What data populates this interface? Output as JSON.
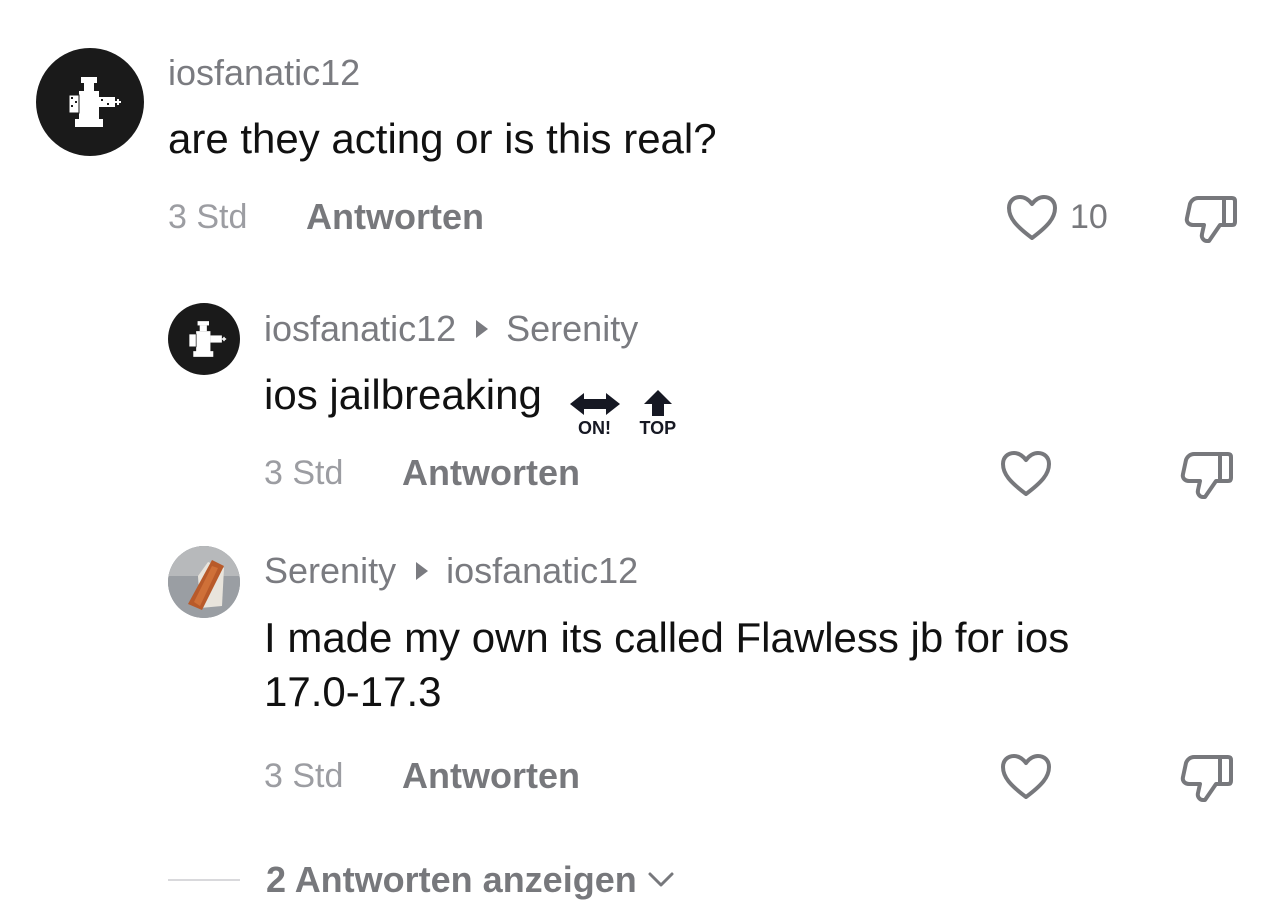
{
  "comments": [
    {
      "username": "iosfanatic12",
      "reply_to": "",
      "text": "are they acting or is this real?",
      "time": "3 Std",
      "reply_label": "Antworten",
      "likes": "10",
      "avatar_icon": "chess-rook-icon"
    },
    {
      "username": "iosfanatic12",
      "reply_to": "Serenity",
      "text": "ios jailbreaking",
      "emoji": [
        "ON!",
        "TOP"
      ],
      "time": "3 Std",
      "reply_label": "Antworten",
      "likes": "",
      "avatar_icon": "chess-rook-icon"
    },
    {
      "username": "Serenity",
      "reply_to": "iosfanatic12",
      "text_line1": "I made my own its called Flawless jb for ios",
      "text_line2": "17.0-17.3",
      "time": "3 Std",
      "reply_label": "Antworten",
      "likes": "",
      "avatar_icon": "photo-avatar"
    }
  ],
  "view_more_label": "2 Antworten anzeigen",
  "icons": {
    "like": "heart-outline-icon",
    "dislike": "thumbs-down-icon",
    "expand": "chevron-down-icon"
  },
  "colors": {
    "text": "#111111",
    "muted": "#77787c",
    "avatar_bg": "#1a1a1a"
  }
}
